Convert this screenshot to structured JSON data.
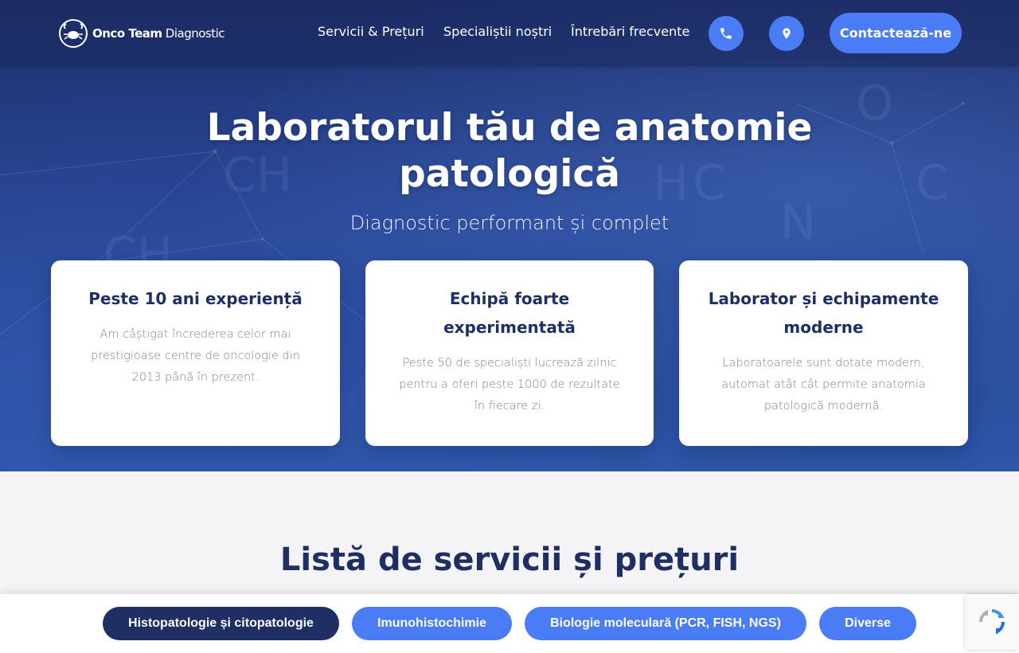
{
  "nav": {
    "logo": {
      "brand_bold": "Onco Team",
      "brand_light": "Diagnostic"
    },
    "links": [
      "Servicii & Prețuri",
      "Specialiștii noștri",
      "Întrebări frecvente"
    ],
    "phone_icon": "phone-icon",
    "location_icon": "map-pin-icon",
    "cta_label": "Contactează-ne"
  },
  "hero": {
    "title_line1": "Laboratorul tău de anatomie",
    "title_line2": "patologică",
    "subtitle": "Diagnostic performant și complet"
  },
  "cards": [
    {
      "title": "Peste 10 ani experiență",
      "text": "Am câștigat încrederea celor mai prestigioase centre de oncologie din 2013 până în prezent."
    },
    {
      "title": "Echipă foarte experimentată",
      "text": "Peste 50 de specialiști lucrează zilnic pentru a oferi peste 1000 de rezultate în fiecare zi."
    },
    {
      "title": "Laborator și echipamente moderne",
      "text": "Laboratoarele sunt dotate modern, automat atât cât permite anatomia patologică modernă."
    }
  ],
  "services": {
    "title": "Listă de servicii și prețuri",
    "tabs": [
      "Histopatologie și citopatologie",
      "Imunohistochimie",
      "Biologie moleculară (PCR, FISH, NGS)",
      "Diverse"
    ],
    "active_tab_index": 0
  },
  "colors": {
    "primary_blue": "#4a7cf6",
    "navy": "#1f2f63",
    "hero_dark": "#1f3270"
  }
}
